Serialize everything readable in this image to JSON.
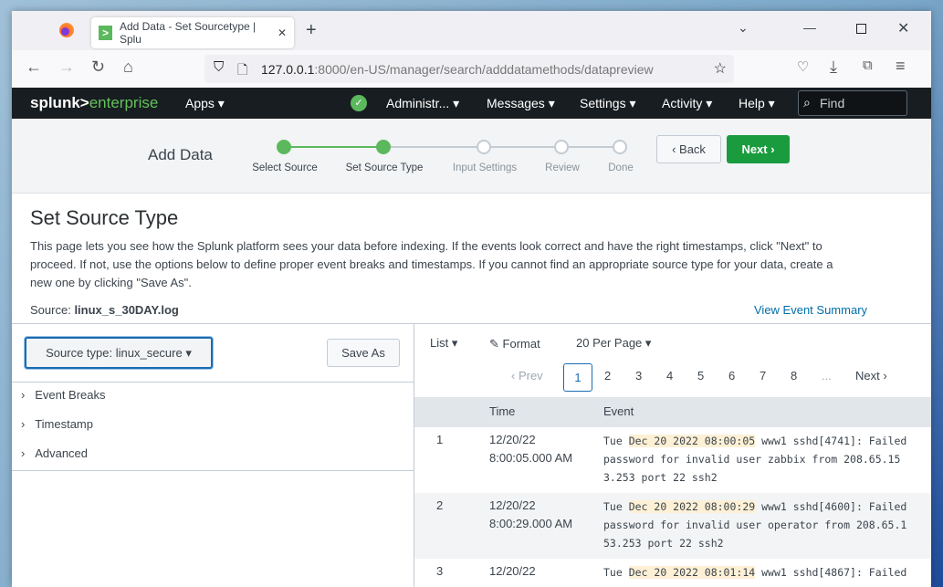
{
  "browser": {
    "tab_title": "Add Data - Set Sourcetype | Splu",
    "url_host": "127.0.0.1",
    "url_rest": ":8000/en-US/manager/search/adddatamethods/datapreview"
  },
  "splunk": {
    "logo_a": "splunk>",
    "logo_b": "enterprise",
    "apps": "Apps ▾",
    "admin": "Administr... ▾",
    "messages": "Messages ▾",
    "settings": "Settings ▾",
    "activity": "Activity ▾",
    "help": "Help ▾",
    "find": "Find"
  },
  "wizard": {
    "title": "Add Data",
    "steps": [
      "Select Source",
      "Set Source Type",
      "Input Settings",
      "Review",
      "Done"
    ],
    "back": "‹ Back",
    "next": "Next ›"
  },
  "page": {
    "title": "Set Source Type",
    "description": "This page lets you see how the Splunk platform sees your data before indexing. If the events look correct and have the right timestamps, click \"Next\" to proceed. If not, use the options below to define proper event breaks and timestamps. If you cannot find an appropriate source type for your data, create a new one by clicking \"Save As\".",
    "source_label": "Source:",
    "source_value": "linux_s_30DAY.log",
    "view_summary": "View Event Summary"
  },
  "left": {
    "sourcetype": "Source type: linux_secure ▾",
    "save_as": "Save As",
    "sections": [
      "Event Breaks",
      "Timestamp",
      "Advanced"
    ]
  },
  "right": {
    "list": "List ▾",
    "format": "Format",
    "per_page": "20 Per Page ▾",
    "prev": "‹ Prev",
    "pages": [
      "1",
      "2",
      "3",
      "4",
      "5",
      "6",
      "7",
      "8",
      "..."
    ],
    "next": "Next ›",
    "col_time": "Time",
    "col_event": "Event",
    "rows": [
      {
        "n": "1",
        "date": "12/20/22",
        "time": "8:00:05.000 AM",
        "pre": "Tue ",
        "ts": "Dec 20 2022 08:00:05",
        "l1": " www1 sshd[4741]: Failed",
        "l2": "password for invalid user zabbix from 208.65.15",
        "l3": "3.253 port 22 ssh2"
      },
      {
        "n": "2",
        "date": "12/20/22",
        "time": "8:00:29.000 AM",
        "pre": "Tue ",
        "ts": "Dec 20 2022 08:00:29",
        "l1": " www1 sshd[4600]: Failed",
        "l2": "password for invalid user operator from 208.65.1",
        "l3": "53.253 port 22 ssh2"
      },
      {
        "n": "3",
        "date": "12/20/22",
        "time": "",
        "pre": "Tue ",
        "ts": "Dec 20 2022 08:01:14",
        "l1": " www1 sshd[4867]: Failed",
        "l2": "",
        "l3": ""
      }
    ]
  }
}
